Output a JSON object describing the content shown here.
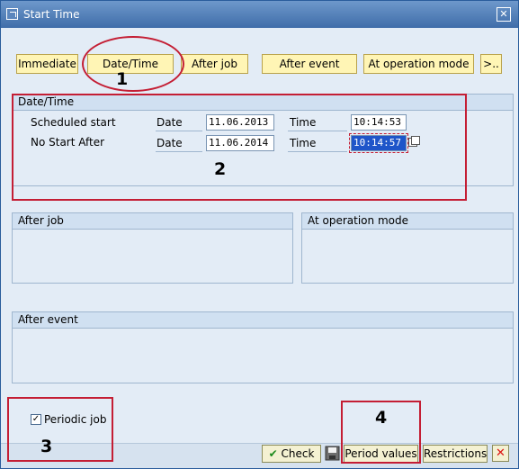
{
  "window": {
    "title": "Start Time"
  },
  "toolbar": {
    "immediate_label": "Immediate",
    "datetime_label": "Date/Time",
    "after_job_label": "After job",
    "after_event_label": "After event",
    "at_operation_mode_label": "At operation mode",
    "more_label": ">.."
  },
  "datetime_group": {
    "title": "Date/Time",
    "scheduled_start_label": "Scheduled start",
    "no_start_after_label": "No Start After",
    "date_label": "Date",
    "time_label": "Time",
    "scheduled_start_date": "11.06.2013",
    "scheduled_start_time": "10:14:53",
    "no_start_after_date": "11.06.2014",
    "no_start_after_time": "10:14:57"
  },
  "after_job_group": {
    "title": "After job"
  },
  "at_operation_mode_group": {
    "title": "At operation mode"
  },
  "after_event_group": {
    "title": "After event"
  },
  "periodic_job": {
    "label": "Periodic job",
    "checked": true
  },
  "buttons": {
    "check_label": "Check",
    "period_values_label": "Period values",
    "restrictions_label": "Restrictions"
  },
  "annotations": [
    "1",
    "2",
    "3",
    "4"
  ],
  "colors": {
    "annotation": "#c41e34",
    "titlebar": "#3f6da9",
    "toolbar_button": "#fff5b5"
  }
}
